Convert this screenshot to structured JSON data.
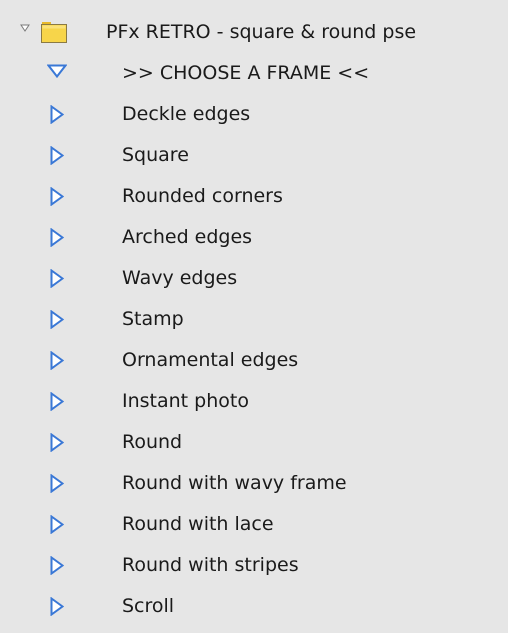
{
  "root": {
    "label": "PFx RETRO - square & round pse",
    "expanded": true,
    "disclosure_icon": "small-down-triangle-icon",
    "folder_icon": "folder-icon",
    "folder_color": "#f5d13a"
  },
  "colors": {
    "background": "#e6e6e6",
    "triangle_stroke": "#3a78d6",
    "triangle_fill": "#ffffff",
    "text": "#1a1a1a"
  },
  "items": [
    {
      "label": ">> CHOOSE A FRAME <<",
      "expanded": true,
      "icon": "expanded-triangle-icon"
    },
    {
      "label": "Deckle edges",
      "expanded": false,
      "icon": "collapsed-triangle-icon"
    },
    {
      "label": "Square",
      "expanded": false,
      "icon": "collapsed-triangle-icon"
    },
    {
      "label": "Rounded corners",
      "expanded": false,
      "icon": "collapsed-triangle-icon"
    },
    {
      "label": "Arched edges",
      "expanded": false,
      "icon": "collapsed-triangle-icon"
    },
    {
      "label": "Wavy edges",
      "expanded": false,
      "icon": "collapsed-triangle-icon"
    },
    {
      "label": "Stamp",
      "expanded": false,
      "icon": "collapsed-triangle-icon"
    },
    {
      "label": "Ornamental edges",
      "expanded": false,
      "icon": "collapsed-triangle-icon"
    },
    {
      "label": "Instant photo",
      "expanded": false,
      "icon": "collapsed-triangle-icon"
    },
    {
      "label": "Round",
      "expanded": false,
      "icon": "collapsed-triangle-icon"
    },
    {
      "label": "Round with wavy frame",
      "expanded": false,
      "icon": "collapsed-triangle-icon"
    },
    {
      "label": "Round with lace",
      "expanded": false,
      "icon": "collapsed-triangle-icon"
    },
    {
      "label": "Round with stripes",
      "expanded": false,
      "icon": "collapsed-triangle-icon"
    },
    {
      "label": "Scroll",
      "expanded": false,
      "icon": "collapsed-triangle-icon"
    }
  ]
}
